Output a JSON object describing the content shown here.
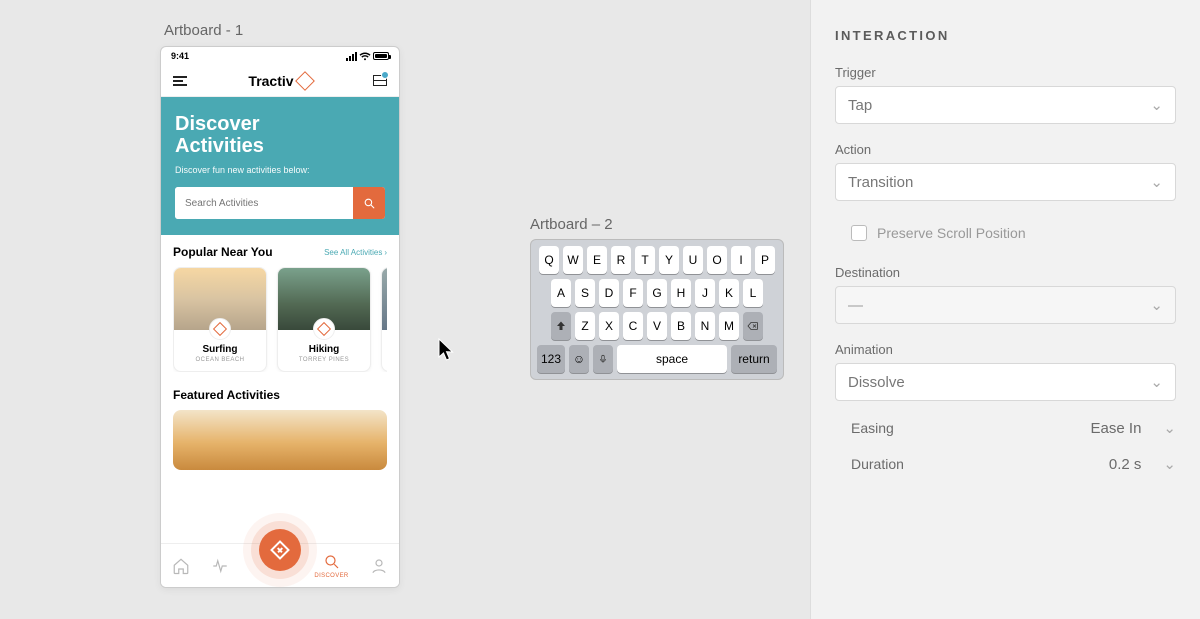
{
  "artboards": {
    "a1_label": "Artboard - 1",
    "a2_label": "Artboard – 2"
  },
  "phone": {
    "status_time": "9:41",
    "brand": "Tractiv",
    "hero_title_1": "Discover",
    "hero_title_2": "Activities",
    "hero_subtitle": "Discover fun new activities below:",
    "search_placeholder": "Search Activities",
    "popular_heading": "Popular Near You",
    "see_all": "See All Activities",
    "cards": [
      {
        "name": "Surfing",
        "location": "OCEAN BEACH"
      },
      {
        "name": "Hiking",
        "location": "TORREY PINES"
      }
    ],
    "featured_heading": "Featured Activities",
    "tab_discover": "DISCOVER"
  },
  "keyboard": {
    "row1": [
      "Q",
      "W",
      "E",
      "R",
      "T",
      "Y",
      "U",
      "O",
      "I",
      "P"
    ],
    "row2": [
      "A",
      "S",
      "D",
      "F",
      "G",
      "H",
      "J",
      "K",
      "L"
    ],
    "row3": [
      "Z",
      "X",
      "C",
      "V",
      "B",
      "N",
      "M"
    ],
    "numkey": "123",
    "space": "space",
    "return": "return"
  },
  "panel": {
    "title": "INTERACTION",
    "trigger_label": "Trigger",
    "trigger_value": "Tap",
    "action_label": "Action",
    "action_value": "Transition",
    "preserve_scroll": "Preserve Scroll Position",
    "destination_label": "Destination",
    "destination_value": "—",
    "animation_label": "Animation",
    "animation_value": "Dissolve",
    "easing_label": "Easing",
    "easing_value": "Ease In",
    "duration_label": "Duration",
    "duration_value": "0.2 s"
  }
}
